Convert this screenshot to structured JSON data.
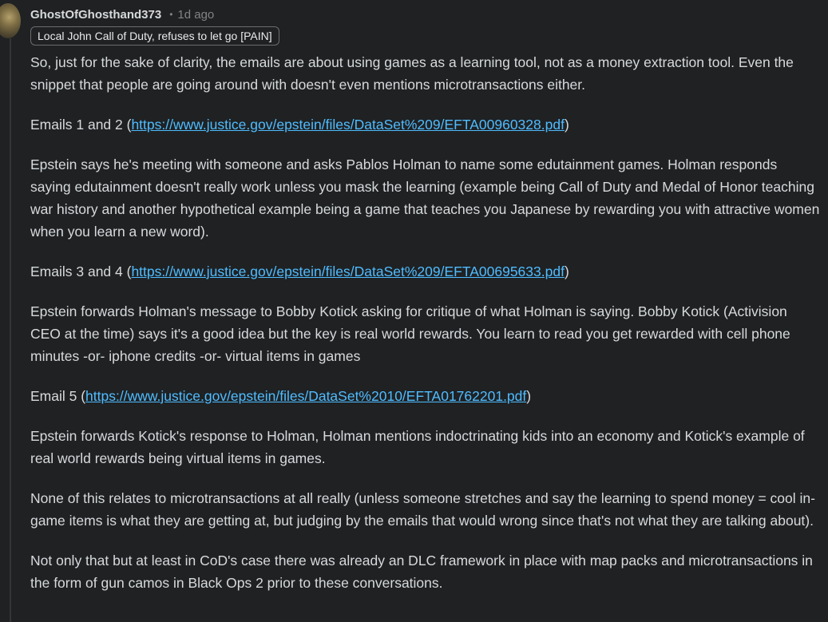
{
  "comment": {
    "username": "GhostOfGhosthand373",
    "separator": "•",
    "timestamp": "1d ago",
    "flair": "Local John Call of Duty, refuses to let go [PAIN]",
    "paragraphs": {
      "p1": "So, just for the sake of clarity, the emails are about using games as a learning tool, not as a money extraction tool. Even the snippet that people are going around with doesn't even mentions microtransactions either.",
      "p2_prefix": "Emails 1 and 2 (",
      "p2_link": "https://www.justice.gov/epstein/files/DataSet%209/EFTA00960328.pdf",
      "p2_suffix": ")",
      "p3": "Epstein says he's meeting with someone and asks Pablos Holman to name some edutainment games. Holman responds saying edutainment doesn't really work unless you mask the learning (example being Call of Duty and Medal of Honor teaching war history and another hypothetical example being a game that teaches you Japanese by rewarding you with attractive women when you learn a new word).",
      "p4_prefix": "Emails 3 and 4 (",
      "p4_link": "https://www.justice.gov/epstein/files/DataSet%209/EFTA00695633.pdf",
      "p4_suffix": ")",
      "p5": "Epstein forwards Holman's message to Bobby Kotick asking for critique of what Holman is saying. Bobby Kotick (Activision CEO at the time) says it's a good idea but the key is real world rewards. You learn to read you get rewarded with cell phone minutes -or- iphone credits -or- virtual items in games",
      "p6_prefix": "Email 5 (",
      "p6_link": "https://www.justice.gov/epstein/files/DataSet%2010/EFTA01762201.pdf",
      "p6_suffix": ")",
      "p7": "Epstein forwards Kotick's response to Holman, Holman mentions indoctrinating kids into an economy and Kotick's example of real world rewards being virtual items in games.",
      "p8": "None of this relates to microtransactions at all really (unless someone stretches and say the learning to spend money = cool in-game items is what they are getting at, but judging by the emails that would wrong since that's not what they are talking about).",
      "p9": "Not only that but at least in CoD's case there was already an DLC framework in place with map packs and microtransactions in the form of gun camos in Black Ops 2 prior to these conversations."
    }
  },
  "colors": {
    "background": "#1f2123",
    "text": "#d7dadc",
    "muted": "#818384",
    "link": "#4fbcff"
  }
}
